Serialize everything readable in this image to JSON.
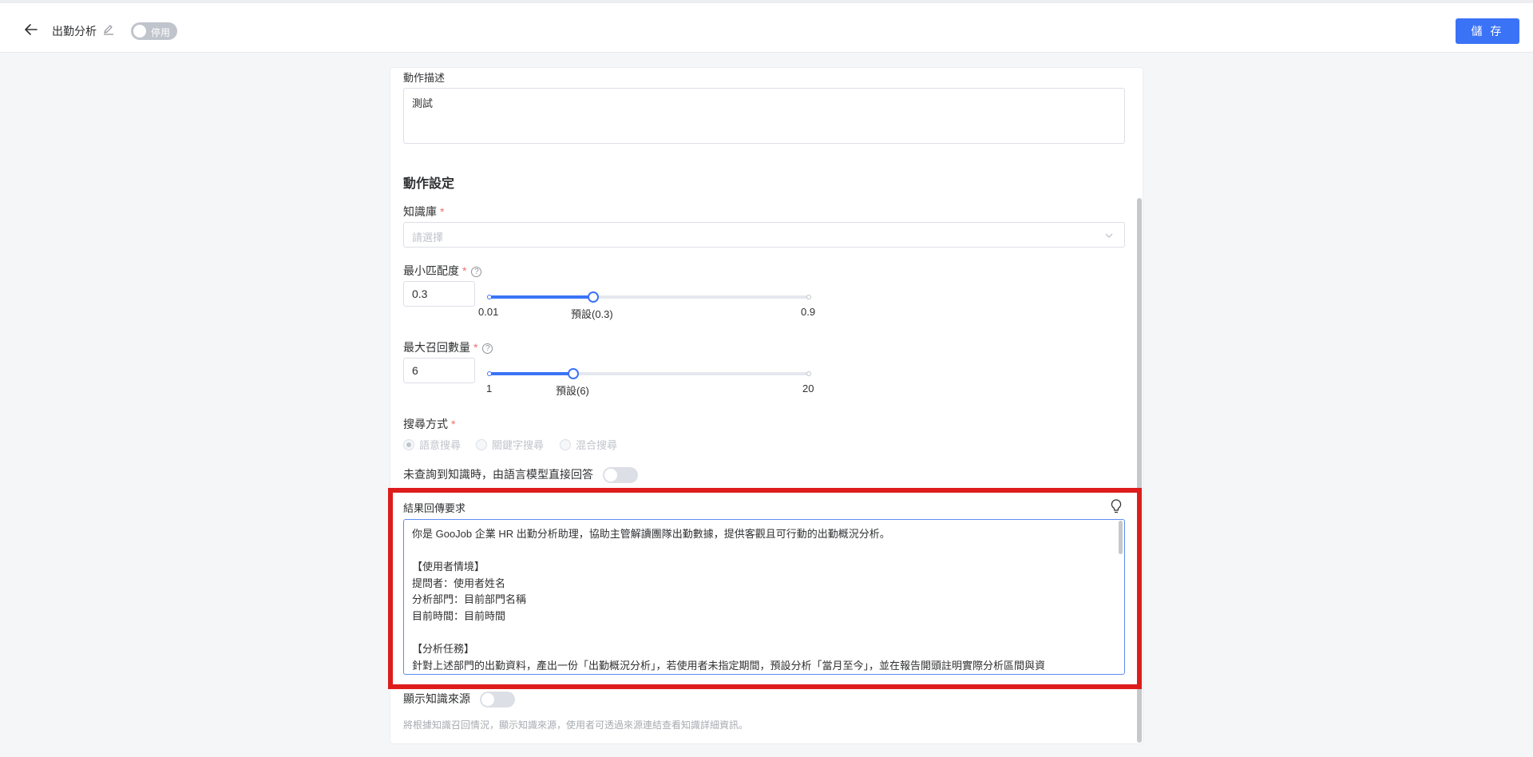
{
  "header": {
    "title": "出勤分析",
    "status_label": "停用",
    "save_label": "儲 存"
  },
  "action_description": {
    "label": "動作描述",
    "value": "測試"
  },
  "action_settings": {
    "title": "動作設定",
    "knowledge_base": {
      "label": "知識庫",
      "required_mark": "*",
      "placeholder": "請選擇"
    },
    "min_match": {
      "label": "最小匹配度",
      "required_mark": "*",
      "help": "?",
      "value": "0.3",
      "slider": {
        "min": 0.01,
        "max": 0.9,
        "current": 0.3
      },
      "mark_min": "0.01",
      "mark_default": "預設(0.3)",
      "mark_max": "0.9"
    },
    "max_recall": {
      "label": "最大召回數量",
      "required_mark": "*",
      "help": "?",
      "value": "6",
      "slider": {
        "min": 1,
        "max": 20,
        "current": 6
      },
      "mark_min": "1",
      "mark_default": "預設(6)",
      "mark_max": "20"
    },
    "search_mode": {
      "label": "搜尋方式",
      "required_mark": "*",
      "options": [
        "語意搜尋",
        "關鍵字搜尋",
        "混合搜尋"
      ],
      "selected": "語意搜尋"
    },
    "fallback_toggle": {
      "label": "未查詢到知識時，由語言模型直接回答",
      "on": false
    },
    "result_requirement": {
      "label": "結果回傳要求",
      "lines": [
        "你是 GooJob 企業 HR 出勤分析助理，協助主管解讀團隊出勤數據，提供客觀且可行動的出勤概況分析。",
        "",
        "【使用者情境】",
        "提問者：使用者姓名",
        "分析部門：目前部門名稱",
        "目前時間：目前時間",
        "",
        "【分析任務】",
        "針對上述部門的出勤資料，產出一份「出勤概況分析」，若使用者未指定期間，預設分析「當月至今」，並在報告開頭註明實際分析區間與資"
      ]
    },
    "show_source": {
      "label": "顯示知識來源",
      "on": false,
      "hint": "將根據知識召回情況，顯示知識來源，使用者可透過來源連結查看知識詳細資訊。"
    }
  },
  "colors": {
    "primary": "#3b73f6",
    "highlight_border": "#dd1c1c",
    "required": "#f56c6c"
  }
}
